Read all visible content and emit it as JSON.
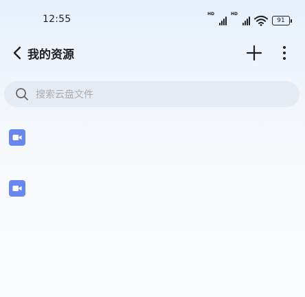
{
  "status_bar": {
    "time": "12:55",
    "network_label_1": "HD",
    "network_label_2": "HD",
    "battery": "91",
    "icons": [
      "signal-icon",
      "signal-icon",
      "wifi-icon",
      "battery-icon"
    ]
  },
  "nav": {
    "title": "我的资源",
    "back_icon": "chevron-left-icon",
    "add_icon": "plus-icon",
    "more_icon": "more-vertical-icon"
  },
  "search": {
    "placeholder": "搜索云盘文件",
    "icon": "search-icon"
  },
  "files": [
    {
      "name": "",
      "meta": "",
      "extra": "",
      "icon": "video-file-icon",
      "icon_color": "#6a87f0"
    },
    {
      "name": "",
      "meta": "",
      "extra": "",
      "icon": "video-file-icon",
      "icon_color": "#6a87f0"
    }
  ],
  "colors": {
    "accent": "#6a87f0",
    "text": "#1b1f24",
    "placeholder": "#a4acb6"
  }
}
